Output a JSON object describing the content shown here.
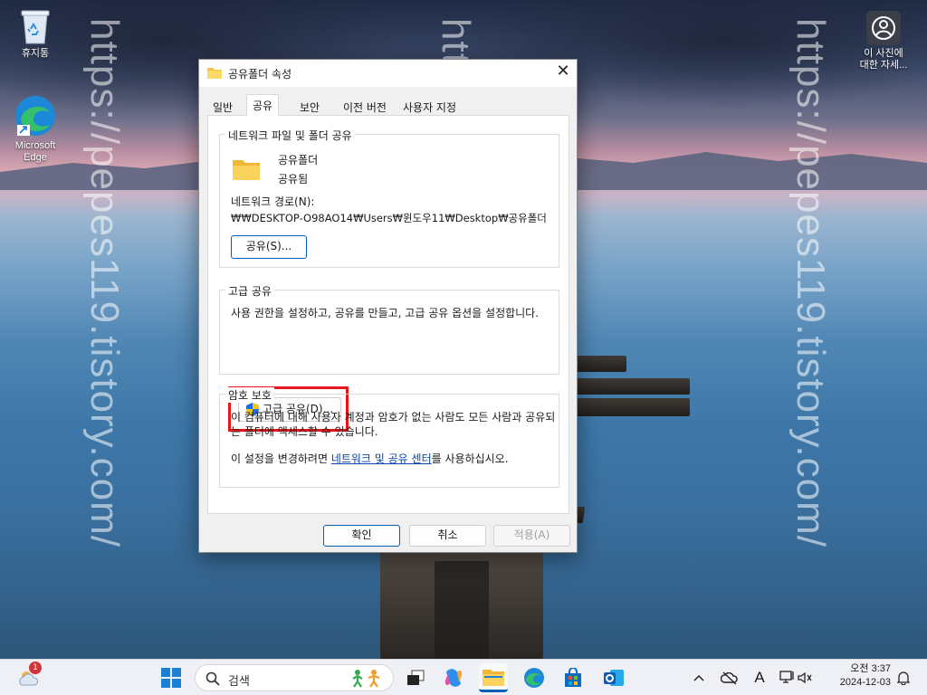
{
  "desktop": {
    "recycle_bin_label": "휴지통",
    "edge_label_line1": "Microsoft",
    "edge_label_line2": "Edge",
    "photo_info_line1": "이 사진에",
    "photo_info_line2": "대한 자세..."
  },
  "watermark": "https://pepes119.tistory.com/",
  "dialog": {
    "title": "공유폴더 속성",
    "close_glyph": "✕",
    "tabs": [
      "일반",
      "공유",
      "보안",
      "이전 버전",
      "사용자 지정"
    ],
    "active_tab": "공유",
    "network_sharing": {
      "group_title": "네트워크 파일 및 폴더 공유",
      "folder_name": "공유폴더",
      "share_status": "공유됨",
      "network_path_label": "네트워크 경로(N):",
      "network_path_value": "₩₩DESKTOP-O98AO14₩Users₩윈도우11₩Desktop₩공유폴더",
      "share_button": "공유(S)..."
    },
    "advanced_sharing": {
      "group_title": "고급 공유",
      "description": "사용 권한을 설정하고, 공유를 만들고, 고급 공유 옵션을 설정합니다.",
      "button": "고급 공유(D)..."
    },
    "password_protection": {
      "group_title": "암호 보호",
      "description": "이 컴퓨터에 대해 사용자 계정과 암호가 없는 사람도 모든 사람과 공유되는 폴더에 액세스할 수 있습니다.",
      "change_prefix": "이 설정을 변경하려면 ",
      "change_link": "네트워크 및 공유 센터",
      "change_suffix": "를 사용하십시오."
    },
    "footer": {
      "ok": "확인",
      "cancel": "취소",
      "apply": "적용(A)"
    }
  },
  "taskbar": {
    "weather_badge": "1",
    "search_placeholder": "검색",
    "time": "오전 3:37",
    "date": "2024-12-03",
    "input_indicator": "A"
  },
  "colors": {
    "accent": "#005fb8",
    "highlight_red": "#e8141b",
    "link": "#0645ad"
  }
}
